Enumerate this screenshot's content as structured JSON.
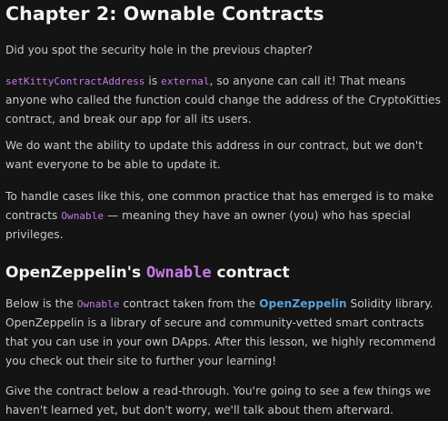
{
  "chapter": {
    "title": "Chapter 2: Ownable Contracts"
  },
  "intro": {
    "question": "Did you spot the security hole in the previous chapter?"
  },
  "explain": {
    "fn_name": "setKittyContractAddress",
    "text_a": " is ",
    "keyword": "external",
    "text_b": ", so anyone can call it! That means anyone who called the function could change the address of the CryptoKitties contract, and break our app for all its users."
  },
  "want": {
    "text": "We do want the ability to update this address in our contract, but we don't want everyone to be able to update it."
  },
  "practice": {
    "text_a": "To handle cases like this, one common practice that has emerged is to make contracts ",
    "code": "Ownable",
    "text_b": " — meaning they have an owner (you) who has special privileges."
  },
  "section": {
    "title_a": "OpenZeppelin's ",
    "title_code": "Ownable",
    "title_b": " contract"
  },
  "below": {
    "text_a": "Below is the ",
    "code": "Ownable",
    "text_b": " contract taken from the ",
    "link": "OpenZeppelin",
    "text_c": " Solidity library. OpenZeppelin is a library of secure and community-vetted smart contracts that you can use in your own DApps. After this lesson, we highly recommend you check out their site to further your learning!"
  },
  "readthrough": {
    "text": "Give the contract below a read-through. You're going to see a few things we haven't learned yet, but don't worry, we'll talk about them afterward."
  },
  "colors": {
    "background": "#141414",
    "heading": "#f2f2f2",
    "body_text": "#c9c9c9",
    "code": "#c779e8",
    "link": "#5aa0d8"
  }
}
